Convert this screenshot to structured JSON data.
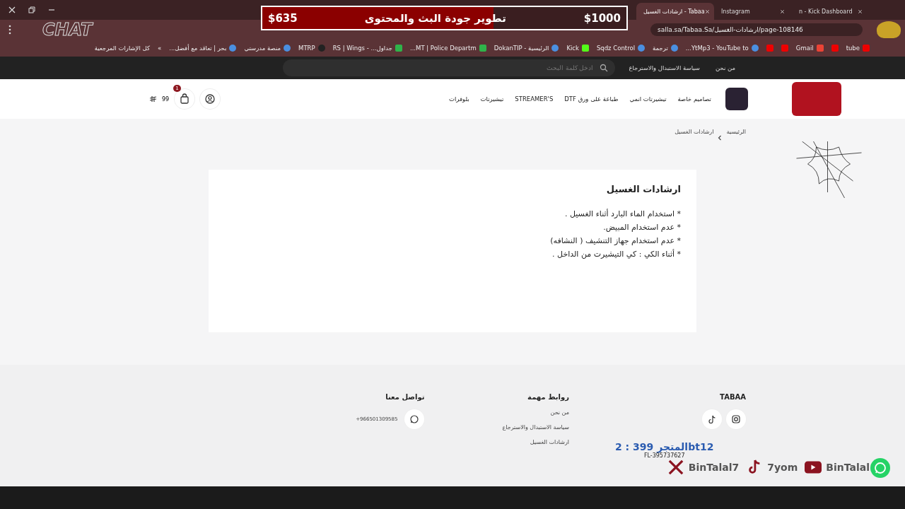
{
  "browser": {
    "tabs": [
      {
        "title": "n - Kick Dashboard",
        "selected": false
      },
      {
        "title": "Instagram",
        "selected": false
      },
      {
        "title": "ارشادات الغسيل - Tabaa",
        "selected": true
      }
    ],
    "address": "salla.sa/Tabaa.Sa/ارشادات-الغسيل/page-108146",
    "bookmarks": [
      {
        "label": "tube",
        "kind": "youtube"
      },
      {
        "kind": "youtube"
      },
      {
        "label": "Gmail",
        "kind": "gmail"
      },
      {
        "kind": "youtube"
      },
      {
        "kind": "youtube"
      },
      {
        "label": "YtMp3 - YouTube to...",
        "kind": "globe"
      },
      {
        "label": "ترجمة",
        "kind": "translate"
      },
      {
        "label": "Sqdz Control",
        "kind": "sync"
      },
      {
        "label": "Kick",
        "kind": "kick"
      },
      {
        "label": "الرئيسية - DokanTIP",
        "kind": "bag"
      },
      {
        "label": "MT | Police Departm...",
        "kind": "sheet"
      },
      {
        "label": "جداول... - RS | Wings",
        "kind": "sheet"
      },
      {
        "label": "MTRP",
        "kind": "mt"
      },
      {
        "label": "منصة مدرستي",
        "kind": "school"
      },
      {
        "label": "بحر | تعاقد مع أفضل...",
        "kind": "wave"
      }
    ],
    "more": "»",
    "all_bookmarks": "كل الإشارات المرجعية"
  },
  "site": {
    "topbar": {
      "links": [
        "من نحن",
        "سياسة الاستبدال والاسترجاع"
      ],
      "search_placeholder": "ادخل كلمة البحث"
    },
    "nav": [
      "تصاميم خاصة",
      "تيشيرتات انمي",
      "طباعة على ورق DTF",
      "STREAMER'S",
      "تيشيرتات",
      "بلوفرات"
    ],
    "cart": {
      "count": "1",
      "total": "99"
    },
    "breadcrumb": [
      "الرئيسية",
      "ارشادات الغسيل"
    ],
    "page": {
      "title": "ارشادات الغسيل",
      "lines": [
        "* استخدام الماء البارد أثناء الغسيل .",
        "* عدم استخدام المبيض.",
        "* عدم استخدام جهاز التنشيف ( النشافه)",
        "* أثناء الكي : كي التيشيرت من الداخل ."
      ]
    },
    "footer": {
      "brand": "TABAA",
      "links_title": "روابط مهمة",
      "links": [
        "من نحن",
        "سياسة الاستبدال والاسترجاع",
        "ارشادات الغسيل"
      ],
      "contact_title": "تواصل معنا",
      "phone": "+966501309585"
    }
  },
  "overlay": {
    "goal": {
      "title": "تطوير جودة البث والمحتوى",
      "raised": "$635",
      "target": "$1000",
      "level": 0.635
    },
    "chat": "CHAT",
    "code": "المتجر 399 : 2bt12",
    "code_id": "FL-395737627",
    "socials": [
      {
        "kind": "youtube",
        "handle": "BinTalal"
      },
      {
        "kind": "tiktok",
        "handle": "7yom"
      },
      {
        "kind": "x",
        "handle": "BinTalal7"
      }
    ]
  }
}
